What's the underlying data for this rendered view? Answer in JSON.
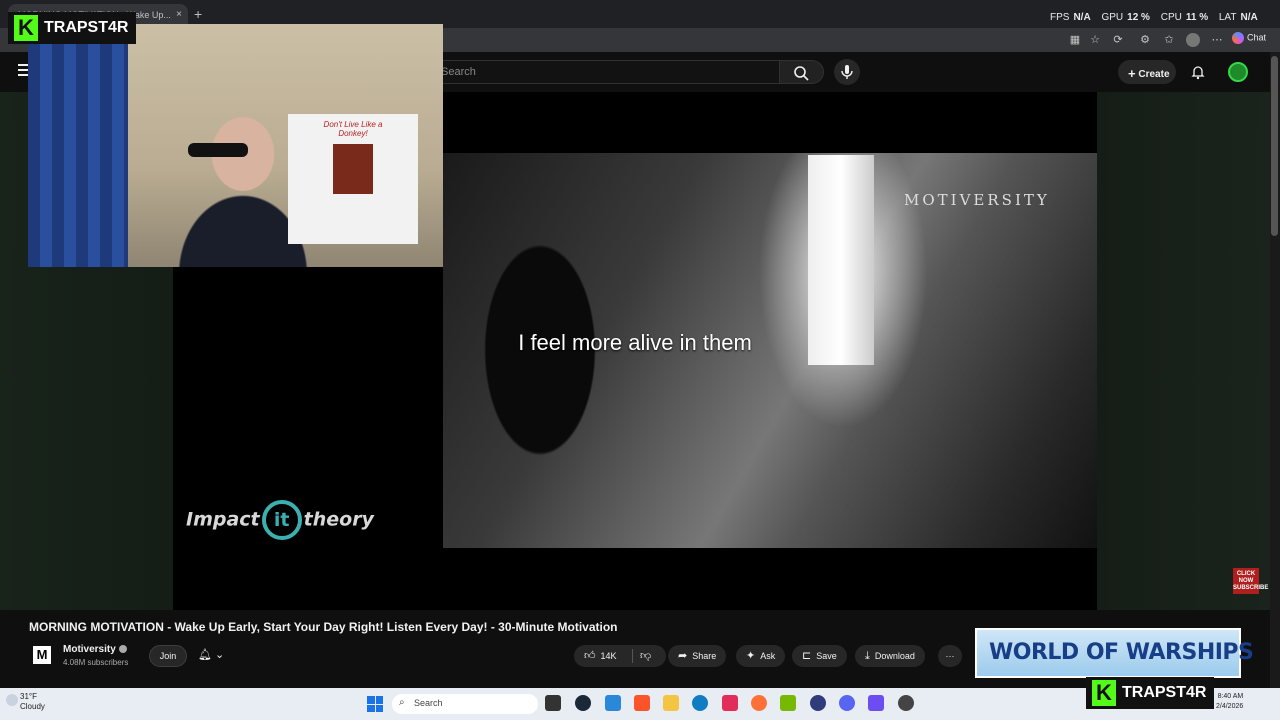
{
  "browser": {
    "tab_title": "MORNING MOTIVATION - Wake Up...",
    "tab_close": "×",
    "new_tab": "+",
    "chat_label": "Chat"
  },
  "perf_overlay": {
    "fps_label": "FPS",
    "fps_value": "N/A",
    "gpu_label": "GPU",
    "gpu_value": "12 %",
    "cpu_label": "CPU",
    "cpu_value": "11 %",
    "lat_label": "LAT",
    "lat_value": "N/A"
  },
  "youtube_header": {
    "search_placeholder": "Search",
    "create_label": "Create"
  },
  "video": {
    "subtitle": "I feel more alive in them",
    "watermark": "MOTIVERSITY",
    "logo_left": "Impact",
    "logo_mid": "it",
    "logo_right": "theory",
    "click_now": "CLICK NOW SUBSCRIBE"
  },
  "webcam": {
    "shirt_caption": "Don't Live Like a Donkey!"
  },
  "streamer": {
    "badge_letter": "K",
    "name": "TRAPST4R"
  },
  "video_info": {
    "title": "MORNING MOTIVATION - Wake Up Early, Start Your Day Right! Listen Every Day! - 30-Minute Motivation",
    "channel_initial": "M",
    "channel_name": "Motiversity",
    "subscribers": "4.08M subscribers",
    "join_label": "Join",
    "like_count": "14K",
    "share_label": "Share",
    "ask_label": "Ask",
    "save_label": "Save",
    "download_label": "Download",
    "more_label": "···"
  },
  "ad": {
    "text": "WORLD OF WARSHIPS"
  },
  "taskbar": {
    "temperature": "31°F",
    "condition": "Cloudy",
    "search_label": "Search",
    "time": "8:40 AM",
    "date": "2/4/2026"
  },
  "colors": {
    "kick_green": "#53fc18",
    "yt_bg": "#0f0f0f",
    "pill_bg": "#272727"
  }
}
